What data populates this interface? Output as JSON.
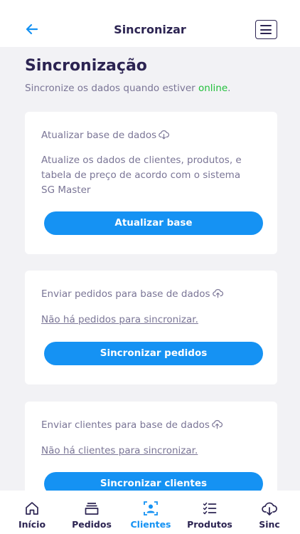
{
  "header": {
    "title": "Sincronizar",
    "back_icon": "arrow-left-icon",
    "menu_icon": "hamburger-menu-icon"
  },
  "page": {
    "title": "Sincronização",
    "subtitle_prefix": "Sincronize os dados quando estiver ",
    "subtitle_status": "online",
    "subtitle_suffix": "."
  },
  "cards": [
    {
      "title": "Atualizar base de dados",
      "icon": "cloud-download-icon",
      "description": "Atualize os dados de clientes, produtos, e tabela de preço de acordo com o sistema SG Master",
      "button": "Atualizar base"
    },
    {
      "title": "Enviar pedidos para base de dados",
      "icon": "cloud-upload-icon",
      "message": "Não há pedidos para sincronizar.",
      "button": "Sincronizar pedidos"
    },
    {
      "title": "Enviar clientes para base de dados",
      "icon": "cloud-upload-icon",
      "message": "Não há clientes para sincronizar.",
      "button": "Sincronizar clientes"
    }
  ],
  "nav": {
    "items": [
      {
        "label": "Início",
        "icon": "home-icon"
      },
      {
        "label": "Pedidos",
        "icon": "orders-icon"
      },
      {
        "label": "Clientes",
        "icon": "clients-icon",
        "active": true
      },
      {
        "label": "Produtos",
        "icon": "products-list-icon"
      },
      {
        "label": "Sinc",
        "icon": "cloud-sync-icon"
      }
    ]
  },
  "colors": {
    "accent": "#1592f3",
    "online": "#22c03b",
    "text_dark": "#2c2452",
    "text_muted": "#7a7596",
    "background": "#f2f2f5"
  }
}
